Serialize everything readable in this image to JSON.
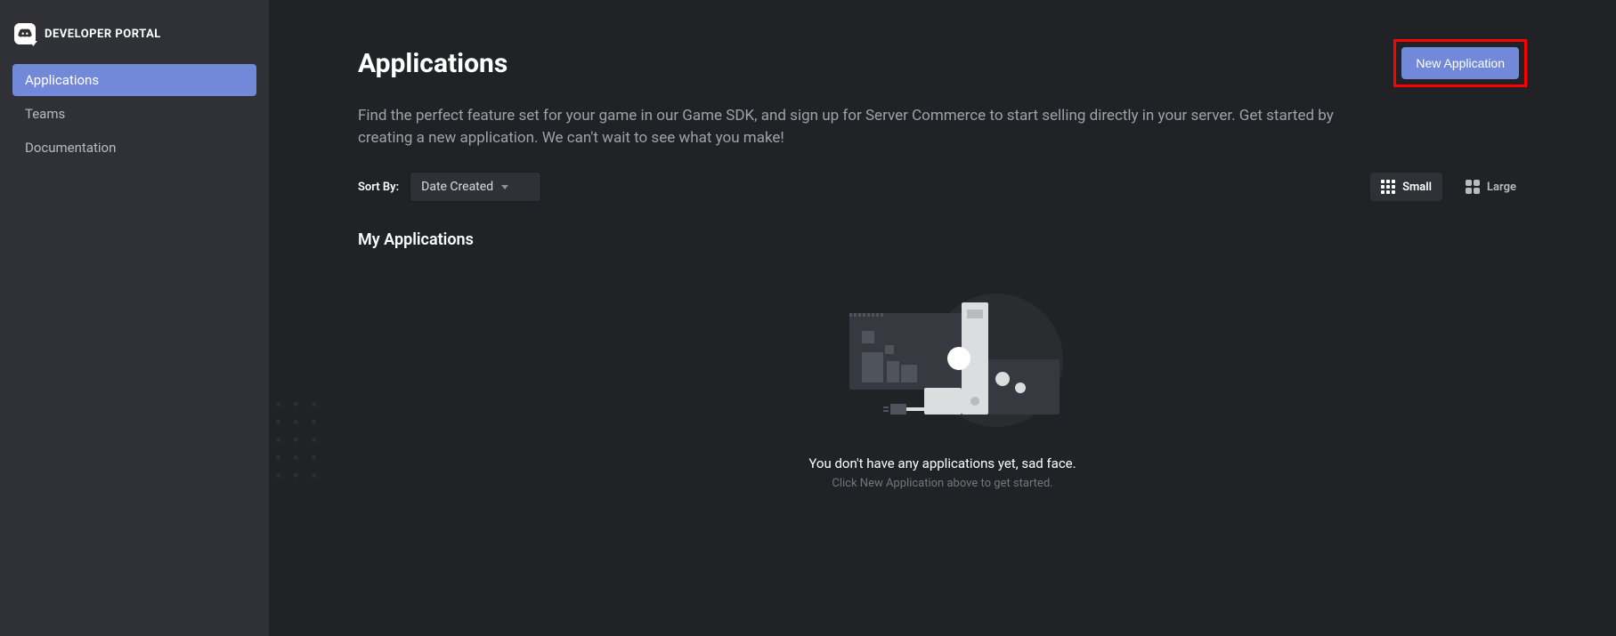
{
  "brand": {
    "label": "DEVELOPER PORTAL"
  },
  "sidebar": {
    "items": [
      {
        "label": "Applications",
        "active": true
      },
      {
        "label": "Teams",
        "active": false
      },
      {
        "label": "Documentation",
        "active": false
      }
    ]
  },
  "header": {
    "title": "Applications",
    "new_app_label": "New Application"
  },
  "intro_text": "Find the perfect feature set for your game in our Game SDK, and sign up for Server Commerce to start selling directly in your server. Get started by creating a new application. We can't wait to see what you make!",
  "sort": {
    "label": "Sort By:",
    "selected": "Date Created"
  },
  "view": {
    "small_label": "Small",
    "large_label": "Large",
    "active": "small"
  },
  "section_title": "My Applications",
  "empty": {
    "title": "You don't have any applications yet, sad face.",
    "subtitle": "Click New Application above to get started."
  }
}
